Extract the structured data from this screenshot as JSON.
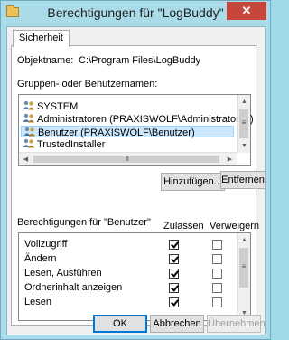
{
  "window": {
    "title": "Berechtigungen für \"LogBuddy\"",
    "close_symbol": "✕"
  },
  "tabs": [
    {
      "label": "Sicherheit"
    }
  ],
  "object": {
    "label": "Objektname:",
    "value": "C:\\Program Files\\LogBuddy"
  },
  "groups": {
    "label": "Gruppen- oder Benutzernamen:",
    "items": [
      {
        "name": "SYSTEM",
        "selected": false
      },
      {
        "name": "Administratoren (PRAXISWOLF\\Administratoren)",
        "selected": false
      },
      {
        "name": "Benutzer (PRAXISWOLF\\Benutzer)",
        "selected": true
      },
      {
        "name": "TrustedInstaller",
        "selected": false
      }
    ]
  },
  "buttons": {
    "add": "Hinzufügen...",
    "remove": "Entfernen",
    "ok": "OK",
    "cancel": "Abbrechen",
    "apply": "Übernehmen"
  },
  "permissions": {
    "label": "Berechtigungen für \"Benutzer\"",
    "allow_header": "Zulassen",
    "deny_header": "Verweigern",
    "rows": [
      {
        "name": "Vollzugriff",
        "allow": true,
        "deny": false
      },
      {
        "name": "Ändern",
        "allow": true,
        "deny": false
      },
      {
        "name": "Lesen, Ausführen",
        "allow": true,
        "deny": false
      },
      {
        "name": "Ordnerinhalt anzeigen",
        "allow": true,
        "deny": false
      },
      {
        "name": "Lesen",
        "allow": true,
        "deny": false
      }
    ]
  },
  "colors": {
    "frame": "#a9dbe9",
    "close": "#c7463b",
    "selection": "#cce8ff",
    "default_border": "#0078d7"
  },
  "icons": {
    "app": "folder-icon",
    "user": "user-group-icon"
  }
}
